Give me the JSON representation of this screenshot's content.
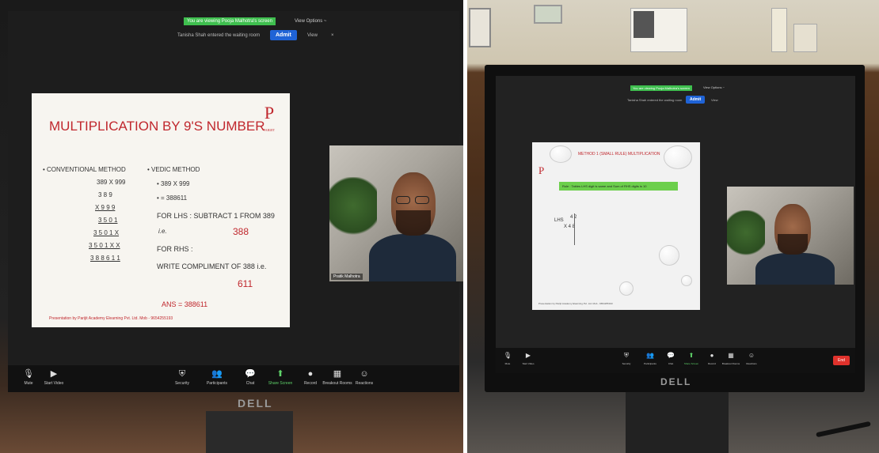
{
  "left_monitor": {
    "banner": "You are viewing Pooja Malhotra's screen",
    "view_options": "View Options ~",
    "waiting_room": "Tanisha Shah entered the waiting room",
    "admit_label": "Admit",
    "view_label": "View",
    "slide": {
      "title": "MULTIPLICATION BY 9'S NUMBER",
      "logo_letter": "P",
      "logo_sub": "PARIJIT",
      "conventional_heading": "• CONVENTIONAL METHOD",
      "conventional_lines": [
        "389 X 999",
        "3 8 9",
        "X 9 9 9",
        "3 5 0 1",
        "3 5 0 1 X",
        "3 5 0 1 X X",
        "3 8 8 6 1 1"
      ],
      "vedic_heading": "• VEDIC METHOD",
      "vedic_line1": "• 389 X 999",
      "vedic_line2": "• = 388611",
      "lhs_text": "FOR LHS : SUBTRACT 1 FROM 389",
      "ie1": "i.e.",
      "lhs_value": "388",
      "rhs_text": "FOR RHS :",
      "compliment_text": "WRITE COMPLIMENT OF 388 i.e.",
      "rhs_value": "611",
      "answer": "ANS = 388611",
      "footer": "Presentation by Parijit Academy Elearning Pvt. Ltd. Mob - 9654255193"
    },
    "video_name": "Pratik Malhotra",
    "toolbar": [
      {
        "label": "Mute",
        "icon": "microphone-icon",
        "glyph": "🎙"
      },
      {
        "label": "Start Video",
        "icon": "video-camera-icon",
        "glyph": "▶"
      },
      {
        "label": "Security",
        "icon": "shield-icon",
        "glyph": "⛨"
      },
      {
        "label": "Participants",
        "icon": "participants-icon",
        "glyph": "👥"
      },
      {
        "label": "Chat",
        "icon": "chat-icon",
        "glyph": "💬"
      },
      {
        "label": "Share Screen",
        "icon": "share-screen-icon",
        "glyph": "⬆"
      },
      {
        "label": "Record",
        "icon": "record-icon",
        "glyph": "●"
      },
      {
        "label": "Breakout Rooms",
        "icon": "breakout-rooms-icon",
        "glyph": "▦"
      },
      {
        "label": "Reactions",
        "icon": "reactions-icon",
        "glyph": "☺"
      }
    ],
    "brand": "DELL"
  },
  "right_monitor": {
    "banner": "You are viewing Pooja Malhotra's screen",
    "view_options": "View Options ~",
    "waiting_room": "Tanisha Shah entered the waiting room",
    "admit_label": "Admit",
    "view_label": "View",
    "slide": {
      "title": "METHOD 1 (SMALL RULE) MULTIPLICATION",
      "logo_letter": "P",
      "rule_text": "Rule : Tables LHS digit is same and Sum of RHS digits is 10",
      "lhs_label": "LHS",
      "row1": "4  2",
      "row2": "X  4  8",
      "footer": "Presentation by Parijit Academy Elearning Pvt. Ltd. Mob - 9654255193"
    },
    "toolbar": [
      {
        "label": "Mute",
        "icon": "microphone-icon",
        "glyph": "🎙"
      },
      {
        "label": "Start Video",
        "icon": "video-camera-icon",
        "glyph": "▶"
      },
      {
        "label": "Security",
        "icon": "shield-icon",
        "glyph": "⛨"
      },
      {
        "label": "Participants",
        "icon": "participants-icon",
        "glyph": "👥"
      },
      {
        "label": "Chat",
        "icon": "chat-icon",
        "glyph": "💬"
      },
      {
        "label": "Share Screen",
        "icon": "share-screen-icon",
        "glyph": "⬆"
      },
      {
        "label": "Record",
        "icon": "record-icon",
        "glyph": "●"
      },
      {
        "label": "Breakout Rooms",
        "icon": "breakout-rooms-icon",
        "glyph": "▦"
      },
      {
        "label": "Reactions",
        "icon": "reactions-icon",
        "glyph": "☺"
      }
    ],
    "end_label": "End",
    "brand": "DELL"
  }
}
